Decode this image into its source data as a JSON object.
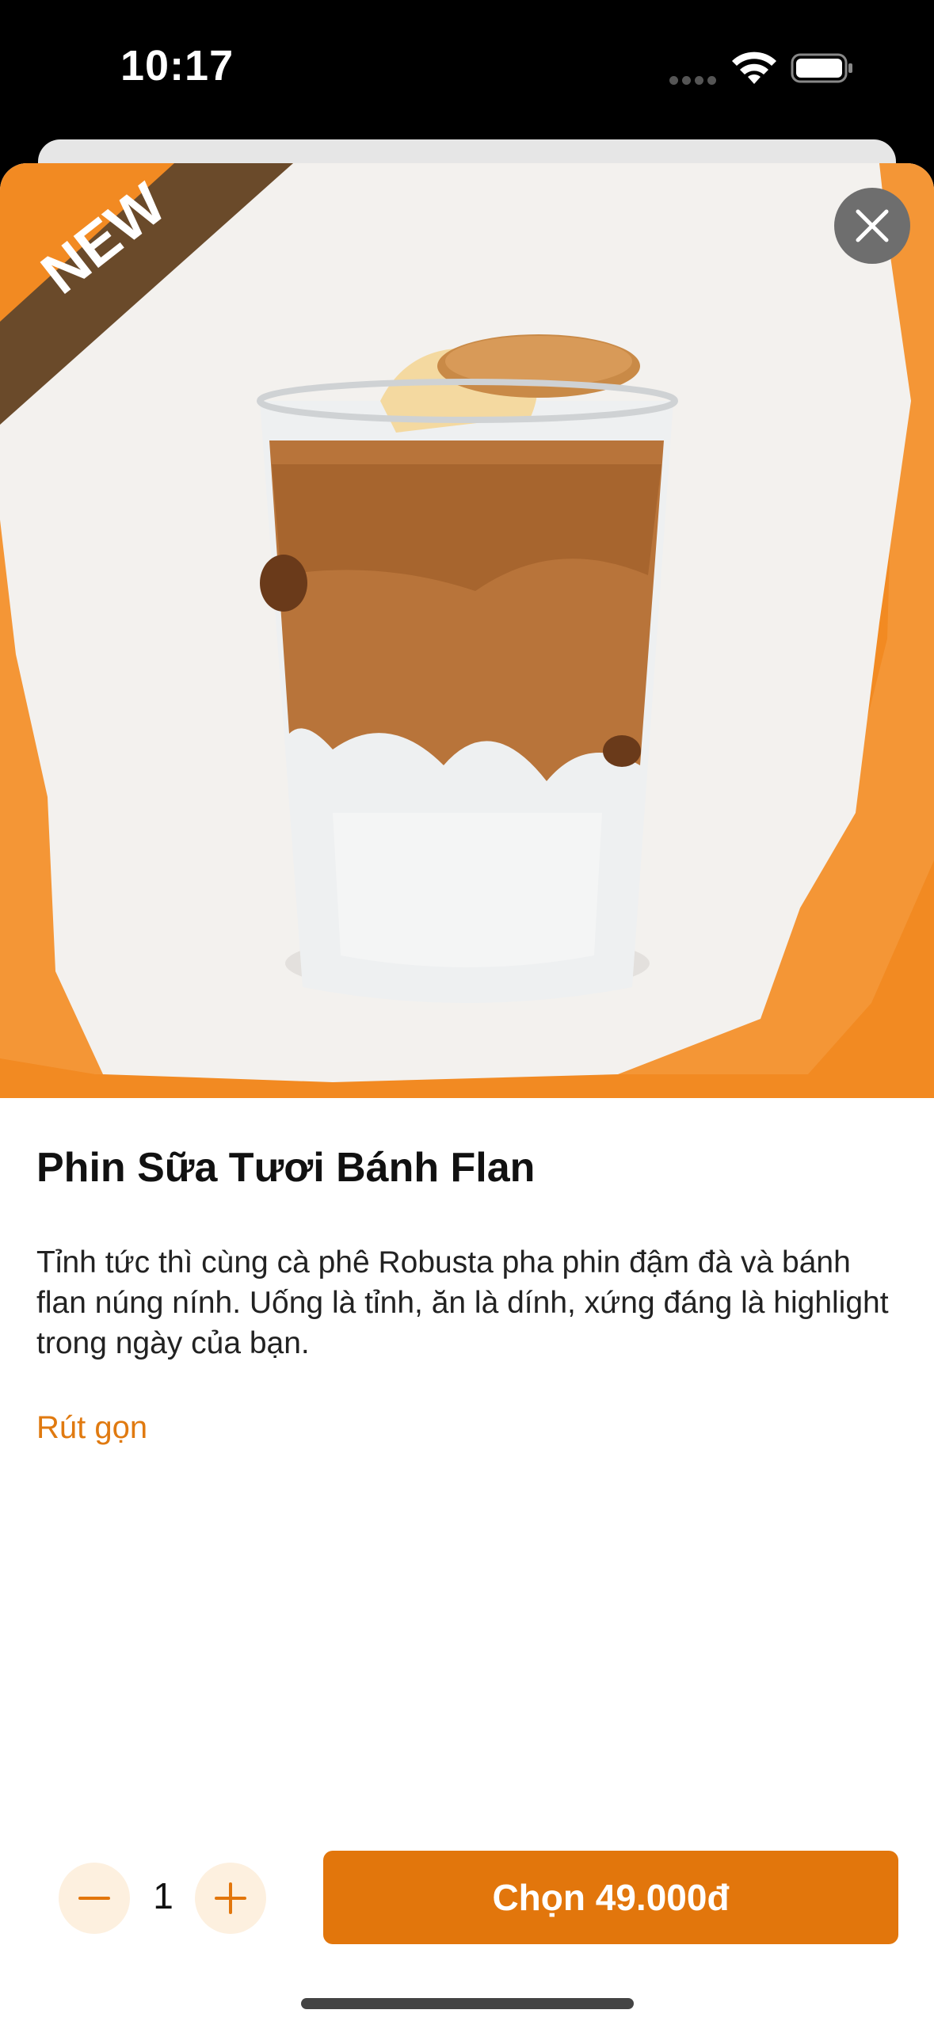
{
  "status_bar": {
    "time": "10:17"
  },
  "hero": {
    "badge": "NEW",
    "image": "iced-coffee-flan-glass"
  },
  "product": {
    "title": "Phin Sữa Tươi Bánh Flan",
    "description": "Tỉnh tức thì cùng cà phê Robusta pha phin đậm đà và bánh flan núng nính. Uống là tỉnh, ăn là dính, xứng đáng là highlight trong ngày của bạn.",
    "collapse_label": "Rút gọn"
  },
  "footer": {
    "quantity": "1",
    "order_label": "Chọn 49.000đ"
  },
  "colors": {
    "accent": "#e2760c",
    "hero_orange": "#f28a22",
    "badge_brown": "#6a4a2a",
    "stepper_bg": "#fdf0df"
  }
}
